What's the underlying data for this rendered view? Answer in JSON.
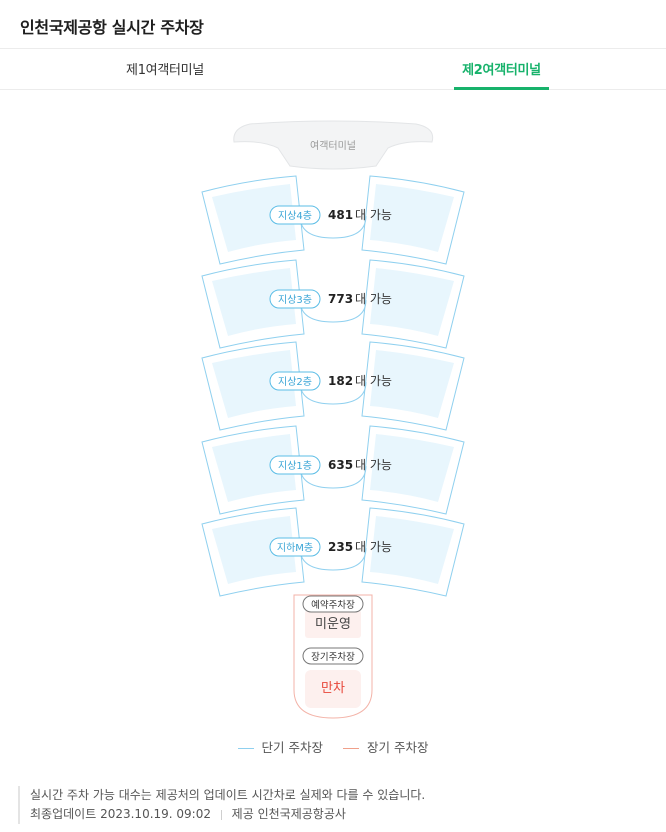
{
  "header": {
    "title": "인천국제공항 실시간 주차장"
  },
  "tabs": [
    {
      "label": "제1여객터미널",
      "active": false
    },
    {
      "label": "제2여객터미널",
      "active": true
    }
  ],
  "terminal": {
    "label": "여객터미널"
  },
  "floors": [
    {
      "name": "지상4층",
      "count": "481",
      "suffix": "대 가능"
    },
    {
      "name": "지상3층",
      "count": "773",
      "suffix": "대 가능"
    },
    {
      "name": "지상2층",
      "count": "182",
      "suffix": "대 가능"
    },
    {
      "name": "지상1층",
      "count": "635",
      "suffix": "대 가능"
    },
    {
      "name": "지하M층",
      "count": "235",
      "suffix": "대 가능"
    }
  ],
  "special_lots": [
    {
      "name": "예약주차장",
      "status": "미운영",
      "status_color": "#444444"
    },
    {
      "name": "장기주차장",
      "status": "만차",
      "status_color": "#e8473a"
    }
  ],
  "legend": [
    {
      "label": "단기 주차장",
      "color": "#8fd0ef"
    },
    {
      "label": "장기 주차장",
      "color": "#f0a08a"
    }
  ],
  "notice": {
    "text": "실시간 주차 가능 대수는 제공처의 업데이트 시간차로 실제와 다를 수 있습니다.",
    "updated_label": "최종업데이트",
    "updated_value": "2023.10.19. 09:02",
    "provider_label": "제공",
    "provider_name": "인천국제공항공사"
  },
  "colors": {
    "accent": "#17b26b",
    "short_term_outline": "#8fd0ef",
    "short_term_fill": "#e8f6fd",
    "long_term_outline": "#f3b3a8",
    "long_term_fill": "#fdf0ee"
  }
}
